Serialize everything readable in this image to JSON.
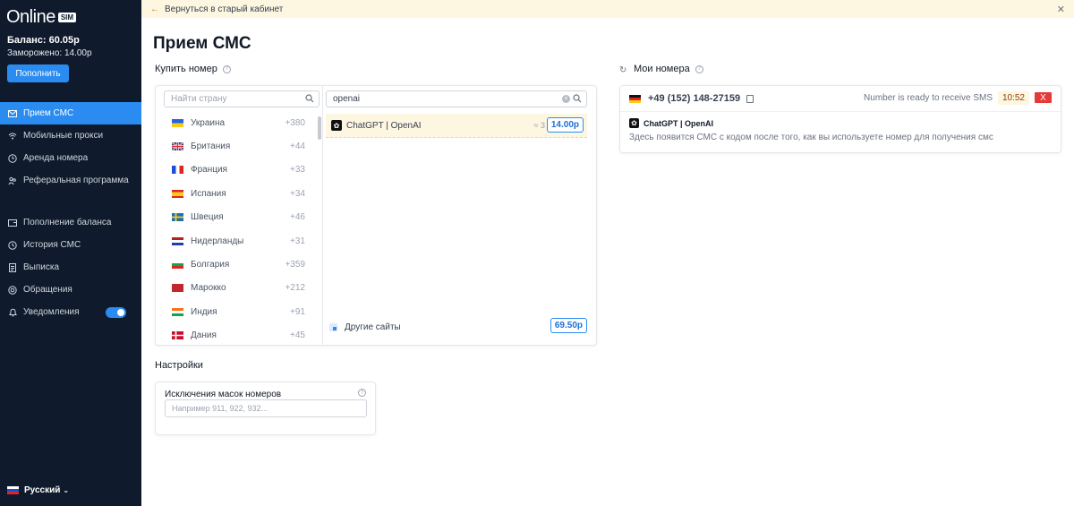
{
  "sidebar": {
    "logo_text": "Online",
    "logo_badge": "SIM",
    "balance": "Баланс: 60.05р",
    "frozen": "Заморожено: 14.00р",
    "topup_label": "Пополнить",
    "nav_group1": [
      {
        "label": "Прием СМС",
        "icon": "envelope-icon",
        "active": true
      },
      {
        "label": "Мобильные прокси",
        "icon": "wifi-icon"
      },
      {
        "label": "Аренда номера",
        "icon": "clock-icon"
      },
      {
        "label": "Реферальная программа",
        "icon": "users-icon"
      }
    ],
    "nav_group2": [
      {
        "label": "Пополнение баланса",
        "icon": "wallet-icon"
      },
      {
        "label": "История СМС",
        "icon": "history-icon"
      },
      {
        "label": "Выписка",
        "icon": "document-icon"
      },
      {
        "label": "Обращения",
        "icon": "support-icon"
      },
      {
        "label": "Уведомления",
        "icon": "bell-icon",
        "toggle": true
      }
    ],
    "language": "Русский"
  },
  "banner": {
    "text": "Вернуться в старый кабинет"
  },
  "page_title": "Прием СМС",
  "buy": {
    "title": "Купить номер",
    "country_search_placeholder": "Найти страну",
    "service_search_value": "openai",
    "countries": [
      {
        "name": "Украина",
        "code": "+380",
        "flag": [
          "#2563eb",
          "#facc15"
        ]
      },
      {
        "name": "Британия",
        "code": "+44",
        "flag": [
          "#1e3a8a",
          "#dc2626"
        ]
      },
      {
        "name": "Франция",
        "code": "+33",
        "flag": [
          "#1d4ed8",
          "#ffffff",
          "#dc2626"
        ]
      },
      {
        "name": "Испания",
        "code": "+34",
        "flag": [
          "#dc2626",
          "#facc15"
        ]
      },
      {
        "name": "Швеция",
        "code": "+46",
        "flag": [
          "#1d6fb8",
          "#facc15"
        ]
      },
      {
        "name": "Нидерланды",
        "code": "+31",
        "flag": [
          "#b91c1c",
          "#ffffff",
          "#1e40af"
        ]
      },
      {
        "name": "Болгария",
        "code": "+359",
        "flag": [
          "#ffffff",
          "#16a34a",
          "#dc2626"
        ]
      },
      {
        "name": "Марокко",
        "code": "+212",
        "flag": [
          "#c1272d",
          "#c1272d"
        ]
      },
      {
        "name": "Индия",
        "code": "+91",
        "flag": [
          "#f97316",
          "#ffffff",
          "#16a34a"
        ]
      },
      {
        "name": "Дания",
        "code": "+45",
        "flag": [
          "#c8102e",
          "#ffffff"
        ]
      }
    ],
    "service": {
      "name": "ChatGPT | OpenAI",
      "approx": "≈ 3",
      "price": "14.00р"
    },
    "other": {
      "name": "Другие сайты",
      "price": "69.50р"
    }
  },
  "settings": {
    "title": "Настройки",
    "exclusion_label": "Исключения масок номеров",
    "exclusion_placeholder": "Например 911, 922, 932..."
  },
  "numbers": {
    "title": "Мои номера",
    "phone": "+49 (152) 148-27159",
    "status": "Number is ready to receive SMS",
    "timer": "10:52",
    "close": "X",
    "service": "ChatGPT | OpenAI",
    "hint": "Здесь появится СМС с кодом после того, как вы используете номер для получения смс"
  }
}
